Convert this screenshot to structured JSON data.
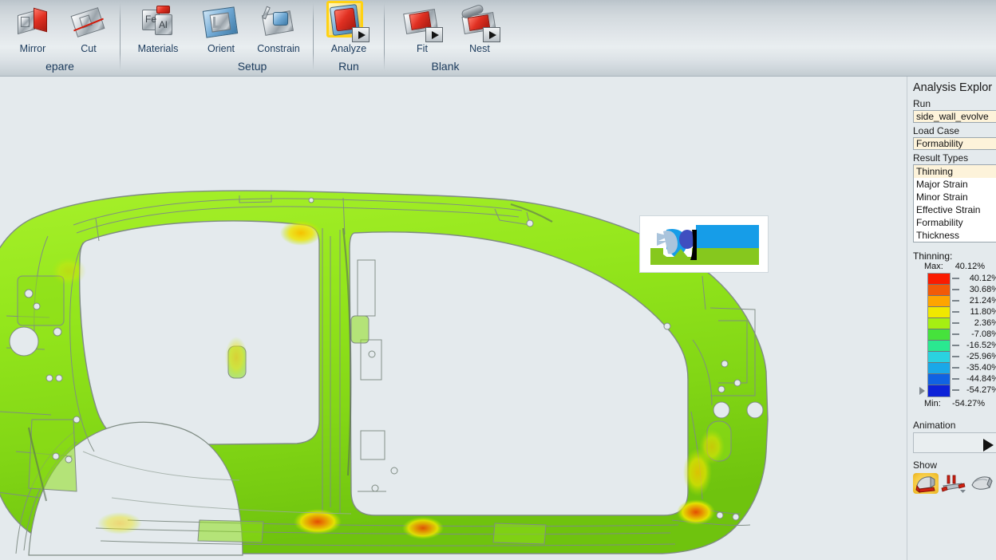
{
  "app": {
    "background_color": "#e4eaed",
    "accent_field_color": "#fdf3da"
  },
  "ribbon": {
    "groups": [
      {
        "name": "prepare",
        "label": "epare",
        "buttons": [
          {
            "name": "mirror",
            "label": "Mirror",
            "icon": "mirror-icon",
            "has_play": false,
            "highlighted": false
          },
          {
            "name": "cut",
            "label": "Cut",
            "icon": "cut-icon",
            "has_play": false,
            "highlighted": false
          }
        ]
      },
      {
        "name": "materials",
        "label": "",
        "buttons": [
          {
            "name": "materials",
            "label": "Materials",
            "icon": "materials-icon",
            "has_play": false,
            "highlighted": false
          }
        ]
      },
      {
        "name": "setup",
        "label": "Setup",
        "buttons": [
          {
            "name": "orient",
            "label": "Orient",
            "icon": "orient-icon",
            "has_play": false,
            "highlighted": false
          },
          {
            "name": "constrain",
            "label": "Constrain",
            "icon": "constrain-icon",
            "has_play": false,
            "highlighted": false
          }
        ]
      },
      {
        "name": "run",
        "label": "Run",
        "buttons": [
          {
            "name": "analyze",
            "label": "Analyze",
            "icon": "analyze-icon",
            "has_play": true,
            "highlighted": true
          }
        ]
      },
      {
        "name": "blank",
        "label": "Blank",
        "buttons": [
          {
            "name": "fit",
            "label": "Fit",
            "icon": "fit-icon",
            "has_play": true,
            "highlighted": false
          },
          {
            "name": "nest",
            "label": "Nest",
            "icon": "nest-icon",
            "has_play": true,
            "highlighted": false
          }
        ]
      }
    ]
  },
  "viewport": {
    "name": "3d-model-viewport",
    "model_description": "automotive side wall body panel formability result",
    "model_colors": {
      "fill_light": "#9ef021",
      "fill_mid": "#8ee218",
      "fill_dark": "#72c310",
      "edge": "#7d8a82",
      "hotspot_yellow": "#f2e400",
      "hotspot_orange": "#f58a00",
      "hotspot_red": "#e81c00"
    }
  },
  "preview_popup": {
    "name": "preview-thumbnail-popup",
    "visible": true,
    "colors": {
      "sky": "#169de8",
      "ground": "#86c81e",
      "shape": "#3f4fc0",
      "shape2": "#aac4dc",
      "dark": "#000000"
    }
  },
  "panel": {
    "title": "Analysis Explor",
    "run": {
      "label": "Run",
      "value": "side_wall_evolve"
    },
    "load_case": {
      "label": "Load Case",
      "value": "Formability"
    },
    "result_types": {
      "label": "Result Types",
      "selected": "Thinning",
      "items": [
        "Thinning",
        "Major Strain",
        "Minor Strain",
        "Effective Strain",
        "Formability",
        "Thickness"
      ]
    },
    "legend": {
      "title": "Thinning:",
      "max_label": "Max:",
      "max_value": "40.12%",
      "min_label": "Min:",
      "min_value": "-54.27%",
      "ticks": [
        {
          "value": "40.12%",
          "color": "#fa1b00"
        },
        {
          "value": "30.68%",
          "color": "#f25a08"
        },
        {
          "value": "21.24%",
          "color": "#ffa400"
        },
        {
          "value": "11.80%",
          "color": "#f0e800"
        },
        {
          "value": "2.36%",
          "color": "#a6ef12"
        },
        {
          "value": "-7.08%",
          "color": "#46e23c"
        },
        {
          "value": "-16.52%",
          "color": "#2ae890"
        },
        {
          "value": "-25.96%",
          "color": "#2ad2e0"
        },
        {
          "value": "-35.40%",
          "color": "#1aa8e8"
        },
        {
          "value": "-44.84%",
          "color": "#1062e2"
        },
        {
          "value": "-54.27%",
          "color": "#0c22d8"
        }
      ]
    },
    "animation": {
      "label": "Animation",
      "play_button": "play-icon"
    },
    "show": {
      "label": "Show",
      "items": [
        {
          "name": "show-part-icon",
          "active": true
        },
        {
          "name": "show-tooling-icon",
          "active": false
        },
        {
          "name": "show-blank-icon",
          "active": false
        }
      ]
    }
  }
}
